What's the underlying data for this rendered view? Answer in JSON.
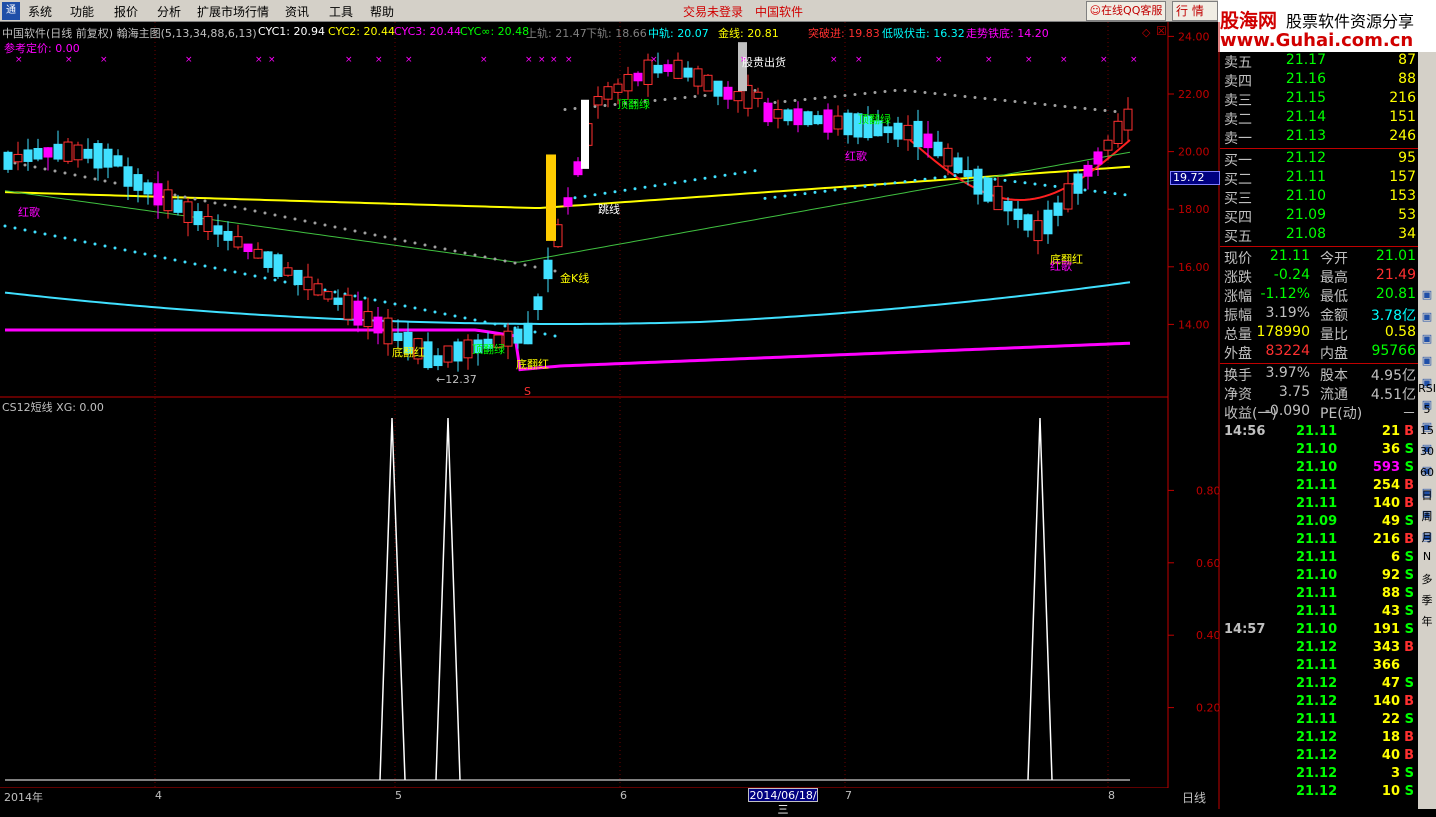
{
  "menu": {
    "items": [
      "系统",
      "功能",
      "报价",
      "分析",
      "扩展市场行情",
      "资讯",
      "工具",
      "帮助"
    ],
    "login": "交易未登录",
    "app_name": "中国软件",
    "qq_button": "在线QQ客服",
    "tab": "行 情"
  },
  "brand": {
    "name": "股海网",
    "slogan": "股票软件资源分享",
    "url": "www.Guhai.com.cn"
  },
  "main_chart": {
    "title": "中国软件(日线 前复权) 翰海主图(5,13,34,88,6,13)",
    "indicators": [
      {
        "label": "CYC1:",
        "value": "20.94",
        "color": "#ffffff"
      },
      {
        "label": "CYC2:",
        "value": "20.44",
        "color": "#ffff00"
      },
      {
        "label": "CYC3:",
        "value": "20.44",
        "color": "#ff00ff"
      },
      {
        "label": "CYC∞:",
        "value": "20.48",
        "color": "#00ff00"
      },
      {
        "label": "上轨:",
        "value": "21.47",
        "color": "#808080"
      },
      {
        "label": "下轨:",
        "value": "18.66",
        "color": "#808080"
      },
      {
        "label": "中轨:",
        "value": "20.07",
        "color": "#00ffff"
      },
      {
        "label": "金线:",
        "value": "20.81",
        "color": "#ffff00"
      },
      {
        "label": "突破进:",
        "value": "19.83",
        "color": "#ff3030"
      },
      {
        "label": "低吸伏击:",
        "value": "16.32",
        "color": "#00ffff"
      },
      {
        "label": "走势铁底:",
        "value": "14.20",
        "color": "#ff00ff"
      }
    ],
    "reference": "参考定价: 0.00",
    "y_ticks": [
      "24.00",
      "22.00",
      "20.00",
      "18.00",
      "16.00",
      "14.00"
    ],
    "current_price_marker": "19.72",
    "annotations": [
      "红歌",
      "顶翻绿",
      "顶翻绿",
      "底翻红",
      "底翻红",
      "跳线",
      "金K线",
      "股贵出货",
      "顶翻绿",
      "红歌",
      "底翻红",
      "红歌",
      "←12.37",
      "S"
    ]
  },
  "sub_chart": {
    "title": "CS12短线 XG: 0.00",
    "y_ticks": [
      "0.80",
      "0.60",
      "0.40",
      "0.20"
    ]
  },
  "x_axis": {
    "labels": [
      "2014年",
      "4",
      "5",
      "6",
      "7",
      "8"
    ],
    "cursor_date": "2014/06/18/三",
    "period": "日线"
  },
  "quote": {
    "asks": [
      {
        "label": "卖五",
        "price": "21.17",
        "vol": "87"
      },
      {
        "label": "卖四",
        "price": "21.16",
        "vol": "88"
      },
      {
        "label": "卖三",
        "price": "21.15",
        "vol": "216"
      },
      {
        "label": "卖二",
        "price": "21.14",
        "vol": "151"
      },
      {
        "label": "卖一",
        "price": "21.13",
        "vol": "246"
      }
    ],
    "bids": [
      {
        "label": "买一",
        "price": "21.12",
        "vol": "95"
      },
      {
        "label": "买二",
        "price": "21.11",
        "vol": "157"
      },
      {
        "label": "买三",
        "price": "21.10",
        "vol": "153"
      },
      {
        "label": "买四",
        "price": "21.09",
        "vol": "53"
      },
      {
        "label": "买五",
        "price": "21.08",
        "vol": "34"
      }
    ],
    "stats": [
      {
        "l1": "现价",
        "v1": "21.11",
        "c1": "#00ff00",
        "l2": "今开",
        "v2": "21.01",
        "c2": "#00ff00"
      },
      {
        "l1": "涨跌",
        "v1": "-0.24",
        "c1": "#00ff00",
        "l2": "最高",
        "v2": "21.49",
        "c2": "#ff3030"
      },
      {
        "l1": "涨幅",
        "v1": "-1.12%",
        "c1": "#00ff00",
        "l2": "最低",
        "v2": "20.81",
        "c2": "#00ff00"
      },
      {
        "l1": "振幅",
        "v1": "3.19%",
        "c1": "#c0c0c0",
        "l2": "金额",
        "v2": "3.78亿",
        "c2": "#00ffff"
      },
      {
        "l1": "总量",
        "v1": "178990",
        "c1": "#ffff00",
        "l2": "量比",
        "v2": "0.58",
        "c2": "#ffff00"
      },
      {
        "l1": "外盘",
        "v1": "83224",
        "c1": "#ff3030",
        "l2": "内盘",
        "v2": "95766",
        "c2": "#00ff00"
      },
      {
        "l1": "换手",
        "v1": "3.97%",
        "c1": "#c0c0c0",
        "l2": "股本",
        "v2": "4.95亿",
        "c2": "#c0c0c0"
      },
      {
        "l1": "净资",
        "v1": "3.75",
        "c1": "#c0c0c0",
        "l2": "流通",
        "v2": "4.51亿",
        "c2": "#c0c0c0"
      },
      {
        "l1": "收益(一)",
        "v1": "-0.090",
        "c1": "#c0c0c0",
        "l2": "PE(动)",
        "v2": "－",
        "c2": "#c0c0c0"
      }
    ]
  },
  "ticks": [
    {
      "time": "14:56",
      "price": "21.11",
      "vol": "21",
      "side": "B"
    },
    {
      "time": "",
      "price": "21.10",
      "vol": "36",
      "side": "S"
    },
    {
      "time": "",
      "price": "21.10",
      "vol": "593",
      "side": "S"
    },
    {
      "time": "",
      "price": "21.11",
      "vol": "254",
      "side": "B"
    },
    {
      "time": "",
      "price": "21.11",
      "vol": "140",
      "side": "B"
    },
    {
      "time": "",
      "price": "21.09",
      "vol": "49",
      "side": "S"
    },
    {
      "time": "",
      "price": "21.11",
      "vol": "216",
      "side": "B"
    },
    {
      "time": "",
      "price": "21.11",
      "vol": "6",
      "side": "S"
    },
    {
      "time": "",
      "price": "21.10",
      "vol": "92",
      "side": "S"
    },
    {
      "time": "",
      "price": "21.11",
      "vol": "88",
      "side": "S"
    },
    {
      "time": "",
      "price": "21.11",
      "vol": "43",
      "side": "S"
    },
    {
      "time": "14:57",
      "price": "21.10",
      "vol": "191",
      "side": "S"
    },
    {
      "time": "",
      "price": "21.12",
      "vol": "343",
      "side": "B"
    },
    {
      "time": "",
      "price": "21.11",
      "vol": "366",
      "side": ""
    },
    {
      "time": "",
      "price": "21.12",
      "vol": "47",
      "side": "S"
    },
    {
      "time": "",
      "price": "21.12",
      "vol": "140",
      "side": "B"
    },
    {
      "time": "",
      "price": "21.11",
      "vol": "22",
      "side": "S"
    },
    {
      "time": "",
      "price": "21.12",
      "vol": "18",
      "side": "B"
    },
    {
      "time": "",
      "price": "21.12",
      "vol": "40",
      "side": "B"
    },
    {
      "time": "",
      "price": "21.12",
      "vol": "3",
      "side": "S"
    },
    {
      "time": "",
      "price": "21.12",
      "vol": "10",
      "side": "S"
    }
  ],
  "sidebar": [
    "RSI",
    "5",
    "15",
    "30",
    "60",
    "日",
    "周",
    "月",
    "N",
    "多",
    "季",
    "年"
  ]
}
